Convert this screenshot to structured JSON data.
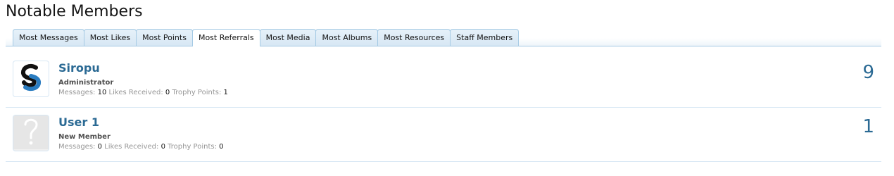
{
  "page": {
    "title": "Notable Members"
  },
  "tabs": [
    {
      "label": "Most Messages",
      "active": false
    },
    {
      "label": "Most Likes",
      "active": false
    },
    {
      "label": "Most Points",
      "active": false
    },
    {
      "label": "Most Referrals",
      "active": true
    },
    {
      "label": "Most Media",
      "active": false
    },
    {
      "label": "Most Albums",
      "active": false
    },
    {
      "label": "Most Resources",
      "active": false
    },
    {
      "label": "Staff Members",
      "active": false
    }
  ],
  "members": [
    {
      "name": "Siropu",
      "title": "Administrator",
      "avatar": "siropu-logo-icon",
      "stats": {
        "messages_label": "Messages:",
        "messages": "10",
        "likes_label": "Likes Received:",
        "likes": "0",
        "trophy_label": "Trophy Points:",
        "trophy": "1"
      },
      "count": "9"
    },
    {
      "name": "User 1",
      "title": "New Member",
      "avatar": "default-avatar-question-icon",
      "stats": {
        "messages_label": "Messages:",
        "messages": "0",
        "likes_label": "Likes Received:",
        "likes": "0",
        "trophy_label": "Trophy Points:",
        "trophy": "0"
      },
      "count": "1"
    }
  ],
  "colors": {
    "accent": "#2b6a94",
    "tab_border": "#a5cae4",
    "tab_bg": "#e6f1f9"
  }
}
